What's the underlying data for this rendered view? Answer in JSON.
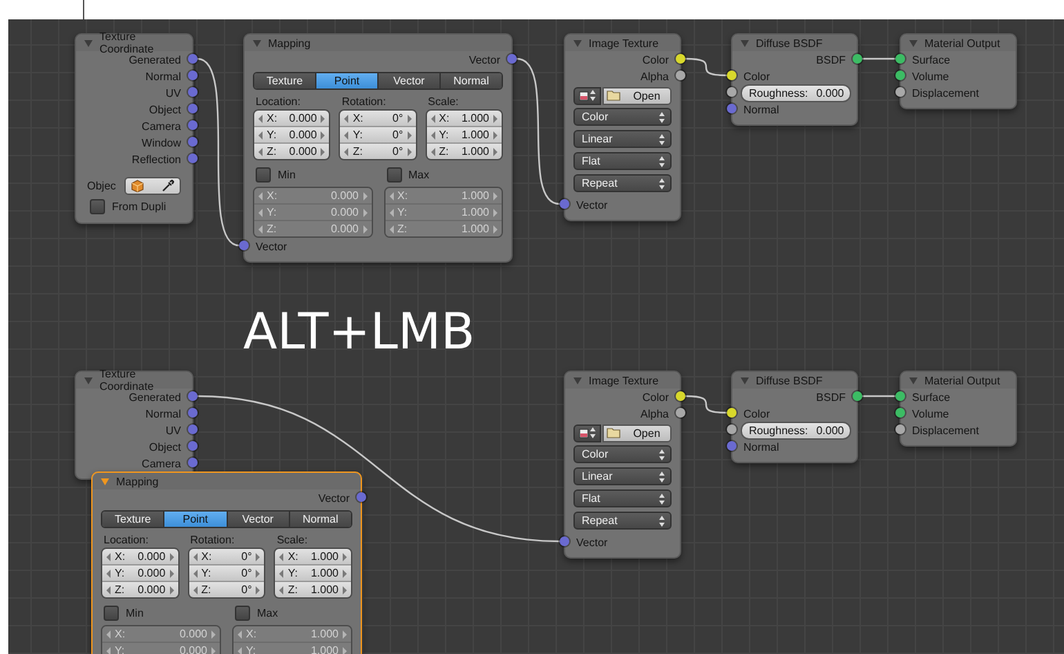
{
  "panels": [
    {
      "nodes": [
        {
          "title": "Texture Coordinate",
          "selected": false,
          "rows": [
            {
              "kind": "out",
              "label": "Generated",
              "color": "#6a6ad0"
            },
            {
              "kind": "out",
              "label": "Normal",
              "color": "#6a6ad0"
            },
            {
              "kind": "out",
              "label": "UV",
              "color": "#6a6ad0"
            },
            {
              "kind": "out",
              "label": "Object",
              "color": "#6a6ad0"
            },
            {
              "kind": "out",
              "label": "Camera",
              "color": "#6a6ad0"
            },
            {
              "kind": "out",
              "label": "Window",
              "color": "#6a6ad0"
            },
            {
              "kind": "out",
              "label": "Reflection",
              "color": "#6a6ad0"
            },
            {
              "kind": "object",
              "label": "Objec"
            },
            {
              "kind": "check",
              "label": "From Dupli",
              "checked": false
            }
          ]
        },
        {
          "title": "Mapping",
          "selected": false,
          "rows": [
            {
              "kind": "out",
              "label": "Vector",
              "color": "#6a6ad0"
            },
            {
              "kind": "tabs",
              "tabs": [
                {
                  "label": "Texture",
                  "selected": false
                },
                {
                  "label": "Point",
                  "selected": true
                },
                {
                  "label": "Vector",
                  "selected": false
                },
                {
                  "label": "Normal",
                  "selected": false
                }
              ]
            },
            {
              "kind": "xyz",
              "groups": [
                {
                  "label": "Location:",
                  "fields": [
                    {
                      "axis": "X:",
                      "value": "0.000"
                    },
                    {
                      "axis": "Y:",
                      "value": "0.000"
                    },
                    {
                      "axis": "Z:",
                      "value": "0.000"
                    }
                  ]
                },
                {
                  "label": "Rotation:",
                  "fields": [
                    {
                      "axis": "X:",
                      "value": "0°"
                    },
                    {
                      "axis": "Y:",
                      "value": "0°"
                    },
                    {
                      "axis": "Z:",
                      "value": "0°"
                    }
                  ]
                },
                {
                  "label": "Scale:",
                  "fields": [
                    {
                      "axis": "X:",
                      "value": "1.000"
                    },
                    {
                      "axis": "Y:",
                      "value": "1.000"
                    },
                    {
                      "axis": "Z:",
                      "value": "1.000"
                    }
                  ]
                }
              ]
            },
            {
              "kind": "minmax",
              "groups": [
                {
                  "label": "Min",
                  "checked": false,
                  "fields": [
                    {
                      "axis": "X:",
                      "value": "0.000"
                    },
                    {
                      "axis": "Y:",
                      "value": "0.000"
                    },
                    {
                      "axis": "Z:",
                      "value": "0.000"
                    }
                  ]
                },
                {
                  "label": "Max",
                  "checked": false,
                  "fields": [
                    {
                      "axis": "X:",
                      "value": "1.000"
                    },
                    {
                      "axis": "Y:",
                      "value": "1.000"
                    },
                    {
                      "axis": "Z:",
                      "value": "1.000"
                    }
                  ]
                }
              ]
            },
            {
              "kind": "in",
              "label": "Vector",
              "color": "#6a6ad0"
            }
          ]
        },
        {
          "title": "Image Texture",
          "selected": false,
          "rows": [
            {
              "kind": "out",
              "label": "Color",
              "color": "#d8d82c"
            },
            {
              "kind": "out",
              "label": "Alpha",
              "color": "#a8a8a8"
            },
            {
              "kind": "file",
              "label": "Open"
            },
            {
              "kind": "select",
              "label": "Color"
            },
            {
              "kind": "select",
              "label": "Linear"
            },
            {
              "kind": "select",
              "label": "Flat"
            },
            {
              "kind": "select",
              "label": "Repeat"
            },
            {
              "kind": "in",
              "label": "Vector",
              "color": "#6a6ad0"
            }
          ]
        },
        {
          "title": "Diffuse BSDF",
          "selected": false,
          "rows": [
            {
              "kind": "out",
              "label": "BSDF",
              "color": "#3cbc64"
            },
            {
              "kind": "in",
              "label": "Color",
              "color": "#d8d82c"
            },
            {
              "kind": "slider",
              "label": "Roughness:",
              "value": "0.000",
              "color": "#a8a8a8"
            },
            {
              "kind": "in",
              "label": "Normal",
              "color": "#6a6ad0"
            }
          ]
        },
        {
          "title": "Material Output",
          "selected": false,
          "rows": [
            {
              "kind": "in",
              "label": "Surface",
              "color": "#3cbc64"
            },
            {
              "kind": "in",
              "label": "Volume",
              "color": "#3cbc64"
            },
            {
              "kind": "in",
              "label": "Displacement",
              "color": "#a8a8a8"
            }
          ]
        }
      ]
    },
    {
      "caption": "ALT+LMB"
    },
    {
      "nodes": [
        {
          "title": "Texture Coordinate",
          "selected": false,
          "rows": [
            {
              "kind": "out",
              "label": "Generated",
              "color": "#6a6ad0"
            },
            {
              "kind": "out",
              "label": "Normal",
              "color": "#6a6ad0"
            },
            {
              "kind": "out",
              "label": "UV",
              "color": "#6a6ad0"
            },
            {
              "kind": "out",
              "label": "Object",
              "color": "#6a6ad0"
            },
            {
              "kind": "out",
              "label": "Camera",
              "color": "#6a6ad0"
            }
          ]
        },
        {
          "title": "Image Texture",
          "selected": false,
          "rows": [
            {
              "kind": "out",
              "label": "Color",
              "color": "#d8d82c"
            },
            {
              "kind": "out",
              "label": "Alpha",
              "color": "#a8a8a8"
            },
            {
              "kind": "file",
              "label": "Open"
            },
            {
              "kind": "select",
              "label": "Color"
            },
            {
              "kind": "select",
              "label": "Linear"
            },
            {
              "kind": "select",
              "label": "Flat"
            },
            {
              "kind": "select",
              "label": "Repeat"
            },
            {
              "kind": "in",
              "label": "Vector",
              "color": "#6a6ad0"
            }
          ]
        },
        {
          "title": "Diffuse BSDF",
          "selected": false,
          "rows": [
            {
              "kind": "out",
              "label": "BSDF",
              "color": "#3cbc64"
            },
            {
              "kind": "in",
              "label": "Color",
              "color": "#d8d82c"
            },
            {
              "kind": "slider",
              "label": "Roughness:",
              "value": "0.000",
              "color": "#a8a8a8"
            },
            {
              "kind": "in",
              "label": "Normal",
              "color": "#6a6ad0"
            }
          ]
        },
        {
          "title": "Material Output",
          "selected": false,
          "rows": [
            {
              "kind": "in",
              "label": "Surface",
              "color": "#3cbc64"
            },
            {
              "kind": "in",
              "label": "Volume",
              "color": "#3cbc64"
            },
            {
              "kind": "in",
              "label": "Displacement",
              "color": "#a8a8a8"
            }
          ]
        },
        {
          "title": "Mapping",
          "selected": true,
          "rows": [
            {
              "kind": "out",
              "label": "Vector",
              "color": "#6a6ad0"
            },
            {
              "kind": "tabs",
              "tabs": [
                {
                  "label": "Texture",
                  "selected": false
                },
                {
                  "label": "Point",
                  "selected": true
                },
                {
                  "label": "Vector",
                  "selected": false
                },
                {
                  "label": "Normal",
                  "selected": false
                }
              ]
            },
            {
              "kind": "xyz",
              "groups": [
                {
                  "label": "Location:",
                  "fields": [
                    {
                      "axis": "X:",
                      "value": "0.000"
                    },
                    {
                      "axis": "Y:",
                      "value": "0.000"
                    },
                    {
                      "axis": "Z:",
                      "value": "0.000"
                    }
                  ]
                },
                {
                  "label": "Rotation:",
                  "fields": [
                    {
                      "axis": "X:",
                      "value": "0°"
                    },
                    {
                      "axis": "Y:",
                      "value": "0°"
                    },
                    {
                      "axis": "Z:",
                      "value": "0°"
                    }
                  ]
                },
                {
                  "label": "Scale:",
                  "fields": [
                    {
                      "axis": "X:",
                      "value": "1.000"
                    },
                    {
                      "axis": "Y:",
                      "value": "1.000"
                    },
                    {
                      "axis": "Z:",
                      "value": "1.000"
                    }
                  ]
                }
              ]
            },
            {
              "kind": "minmax",
              "groups": [
                {
                  "label": "Min",
                  "checked": false,
                  "fields": [
                    {
                      "axis": "X:",
                      "value": "0.000"
                    },
                    {
                      "axis": "Y:",
                      "value": "0.000"
                    }
                  ]
                },
                {
                  "label": "Max",
                  "checked": false,
                  "fields": [
                    {
                      "axis": "X:",
                      "value": "1.000"
                    },
                    {
                      "axis": "Y:",
                      "value": "1.000"
                    }
                  ]
                }
              ]
            }
          ]
        }
      ]
    }
  ]
}
